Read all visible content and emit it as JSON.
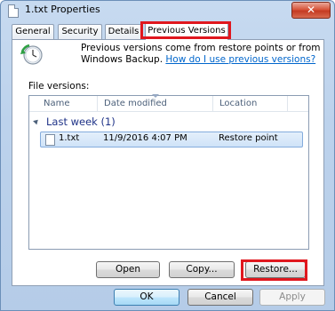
{
  "window": {
    "title": "1.txt Properties",
    "close_label": "✕"
  },
  "tabs": [
    {
      "label": "General"
    },
    {
      "label": "Security"
    },
    {
      "label": "Details"
    },
    {
      "label": "Previous Versions",
      "active": true
    }
  ],
  "info": {
    "text": "Previous versions come from restore points or from Windows Backup.",
    "link": "How do I use previous versions?"
  },
  "file_versions_label": "File versions:",
  "list": {
    "columns": [
      "Name",
      "Date modified",
      "Location"
    ],
    "group_label": "Last week (1)",
    "rows": [
      {
        "name": "1.txt",
        "date": "11/9/2016 4:07 PM",
        "location": "Restore point"
      }
    ]
  },
  "actions": {
    "open": "Open",
    "copy": "Copy...",
    "restore": "Restore..."
  },
  "footer": {
    "ok": "OK",
    "cancel": "Cancel",
    "apply": "Apply"
  },
  "colors": {
    "highlight": "#e0171e",
    "link": "#0066cc",
    "group": "#1e3287"
  }
}
